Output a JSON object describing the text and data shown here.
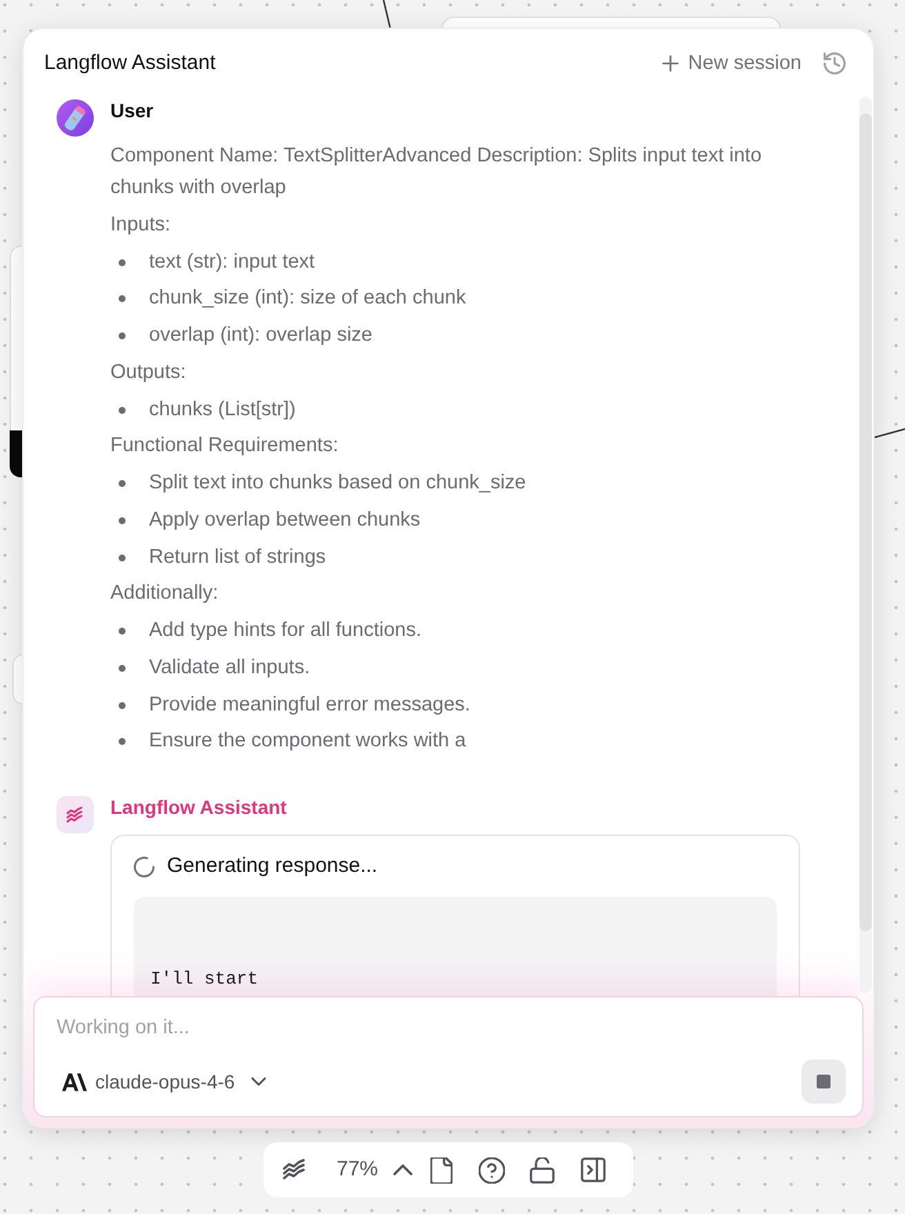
{
  "assistant_panel": {
    "title": "Langflow Assistant",
    "new_session_label": "New session",
    "messages": [
      {
        "kind": "user",
        "author": "User",
        "blocks": [
          {
            "kind": "paragraph",
            "text": "Component Name: TextSplitterAdvanced Description: Splits input text into chunks with overlap"
          },
          {
            "kind": "paragraph",
            "text": "Inputs:"
          },
          {
            "kind": "list",
            "items": [
              "text (str): input text",
              "chunk_size (int): size of each chunk",
              "overlap (int): overlap size"
            ]
          },
          {
            "kind": "paragraph",
            "text": "Outputs:"
          },
          {
            "kind": "list",
            "items": [
              "chunks (List[str])"
            ]
          },
          {
            "kind": "paragraph",
            "text": "Functional Requirements:"
          },
          {
            "kind": "list",
            "items": [
              "Split text into chunks based on chunk_size",
              "Apply overlap between chunks",
              "Return list of strings"
            ]
          },
          {
            "kind": "paragraph",
            "text": "Additionally:"
          },
          {
            "kind": "list",
            "items": [
              "Add type hints for all functions.",
              "Validate all inputs.",
              "Provide meaningful error messages.",
              "Ensure the component works with a"
            ]
          }
        ]
      },
      {
        "kind": "assistant",
        "author": "Langflow Assistant",
        "status": "Generating response...",
        "code": "I'll start"
      }
    ],
    "composer": {
      "placeholder": "Working on it...",
      "model": "claude-opus-4-6"
    }
  },
  "canvas_toolbar": {
    "zoom": "77%"
  }
}
